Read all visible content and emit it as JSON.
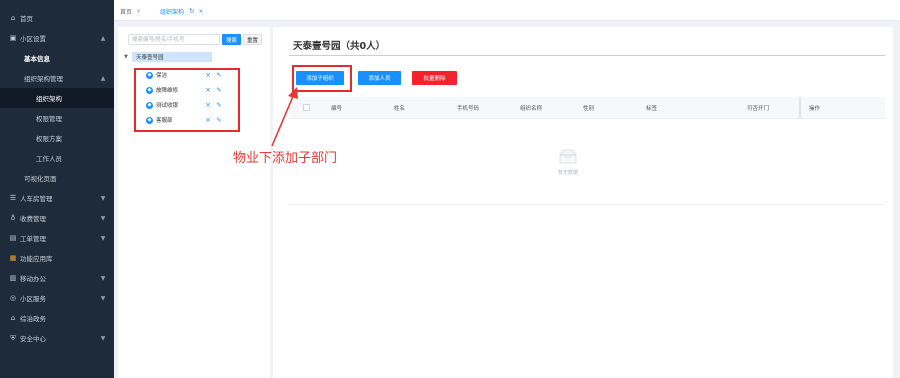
{
  "sidebar": {
    "items": [
      {
        "label": "首页",
        "icon": "home-icon",
        "glyph": "⌂"
      },
      {
        "label": "小区设置",
        "icon": "building-icon",
        "glyph": "▣",
        "arrow": "▲"
      },
      {
        "label": "基本信息"
      },
      {
        "label": "组织架构管理",
        "arrow": "▲"
      },
      {
        "label": "组织架构"
      },
      {
        "label": "权限管理"
      },
      {
        "label": "权限方案"
      },
      {
        "label": "工作人员"
      },
      {
        "label": "可视化页面"
      },
      {
        "label": "人车房管理",
        "icon": "database-icon",
        "glyph": "☰",
        "arrow": "▼"
      },
      {
        "label": "收费管理",
        "icon": "money-icon",
        "glyph": "♁",
        "arrow": "▼"
      },
      {
        "label": "工单管理",
        "icon": "ticket-icon",
        "glyph": "▤",
        "arrow": "▼"
      },
      {
        "label": "功能应用库",
        "icon": "apps-icon",
        "glyph": "▦"
      },
      {
        "label": "移动办公",
        "icon": "office-icon",
        "glyph": "▥",
        "arrow": "▼"
      },
      {
        "label": "小区服务",
        "icon": "service-icon",
        "glyph": "◎",
        "arrow": "▼"
      },
      {
        "label": "综治政务",
        "icon": "gov-icon",
        "glyph": "⌂"
      },
      {
        "label": "安全中心",
        "icon": "security-icon",
        "glyph": "⛨",
        "arrow": "▼"
      }
    ]
  },
  "tabs": [
    {
      "label": "首页",
      "close": "×"
    },
    {
      "label": "组织架构",
      "refresh": "↻",
      "close": "×"
    }
  ],
  "tree": {
    "search_placeholder": "搜索编号/姓名/手机号",
    "search_button": "搜索",
    "reset_button": "重置",
    "root": "天泰壹号园",
    "root_toggle": "▼",
    "children": [
      "保洁",
      "故障维修",
      "测试收银",
      "客服部"
    ],
    "delete_glyph": "×",
    "edit_glyph": "✎",
    "child_glyph": "◆"
  },
  "annotation": {
    "text": "物业下添加子部门"
  },
  "main": {
    "title": "天泰壹号园（共0人）",
    "buttons": {
      "add_org": "添加子组织",
      "add_person": "添加人员",
      "batch_delete": "批量删除"
    },
    "columns": [
      "编号",
      "姓名",
      "手机号码",
      "组织名称",
      "性别",
      "标签",
      "可否开门",
      "操作"
    ],
    "empty_text": "暂无数据"
  },
  "colors": {
    "sidebar_bg": "#1d2b3a",
    "primary": "#1890ff",
    "danger": "#f5222d",
    "annotation": "#e52b2b"
  }
}
